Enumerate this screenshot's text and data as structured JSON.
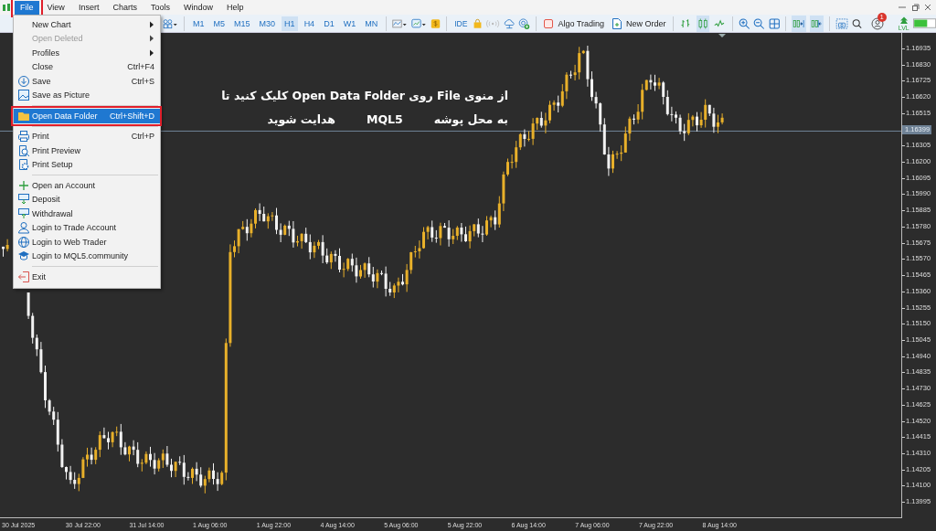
{
  "menubar": {
    "items": [
      {
        "label": "File",
        "selected": true,
        "outlined": true
      },
      {
        "label": "View",
        "selected": false,
        "outlined": false
      },
      {
        "label": "Insert",
        "selected": false,
        "outlined": false
      },
      {
        "label": "Charts",
        "selected": false,
        "outlined": false
      },
      {
        "label": "Tools",
        "selected": false,
        "outlined": false
      },
      {
        "label": "Window",
        "selected": false,
        "outlined": false
      },
      {
        "label": "Help",
        "selected": false,
        "outlined": false
      }
    ]
  },
  "file_menu": {
    "items": [
      {
        "kind": "item",
        "label": "New Chart",
        "submenu": true,
        "disabled": false,
        "selected": false,
        "outlined": false
      },
      {
        "kind": "item",
        "label": "Open Deleted",
        "submenu": true,
        "disabled": true,
        "selected": false,
        "outlined": false
      },
      {
        "kind": "item",
        "label": "Profiles",
        "submenu": true,
        "disabled": false,
        "selected": false,
        "outlined": false
      },
      {
        "kind": "item",
        "label": "Close",
        "shortcut": "Ctrl+F4",
        "submenu": false,
        "disabled": false,
        "selected": false,
        "outlined": false
      },
      {
        "kind": "item",
        "label": "Save",
        "shortcut": "Ctrl+S",
        "submenu": false,
        "disabled": false,
        "selected": false,
        "outlined": false
      },
      {
        "kind": "item",
        "label": "Save as Picture",
        "submenu": false,
        "disabled": false,
        "selected": false,
        "outlined": false
      },
      {
        "kind": "separator"
      },
      {
        "kind": "item",
        "label": "Open Data Folder",
        "shortcut": "Ctrl+Shift+D",
        "submenu": false,
        "disabled": false,
        "selected": true,
        "outlined": true
      },
      {
        "kind": "separator"
      },
      {
        "kind": "item",
        "label": "Print",
        "shortcut": "Ctrl+P",
        "submenu": false,
        "disabled": false,
        "selected": false,
        "outlined": false
      },
      {
        "kind": "item",
        "label": "Print Preview",
        "submenu": false,
        "disabled": false,
        "selected": false,
        "outlined": false
      },
      {
        "kind": "item",
        "label": "Print Setup",
        "submenu": false,
        "disabled": false,
        "selected": false,
        "outlined": false
      },
      {
        "kind": "separator"
      },
      {
        "kind": "item",
        "label": "Open an Account",
        "submenu": false,
        "disabled": false,
        "selected": false,
        "outlined": false
      },
      {
        "kind": "item",
        "label": "Deposit",
        "submenu": false,
        "disabled": false,
        "selected": false,
        "outlined": false
      },
      {
        "kind": "item",
        "label": "Withdrawal",
        "submenu": false,
        "disabled": false,
        "selected": false,
        "outlined": false
      },
      {
        "kind": "item",
        "label": "Login to Trade Account",
        "submenu": false,
        "disabled": false,
        "selected": false,
        "outlined": false
      },
      {
        "kind": "item",
        "label": "Login to Web Trader",
        "submenu": false,
        "disabled": false,
        "selected": false,
        "outlined": false
      },
      {
        "kind": "item",
        "label": "Login to MQL5.community",
        "submenu": false,
        "disabled": false,
        "selected": false,
        "outlined": false
      },
      {
        "kind": "separator"
      },
      {
        "kind": "item",
        "label": "Exit",
        "submenu": false,
        "disabled": false,
        "selected": false,
        "outlined": false
      }
    ]
  },
  "toolbar": {
    "timeframes": [
      {
        "label": "M1",
        "selected": false
      },
      {
        "label": "M5",
        "selected": false
      },
      {
        "label": "M15",
        "selected": false
      },
      {
        "label": "M30",
        "selected": false
      },
      {
        "label": "H1",
        "selected": true
      },
      {
        "label": "H4",
        "selected": false
      },
      {
        "label": "D1",
        "selected": false
      },
      {
        "label": "W1",
        "selected": false
      },
      {
        "label": "MN",
        "selected": false
      }
    ],
    "ide_label": "IDE",
    "algo_trading_label": "Algo Trading",
    "new_order_label": "New Order",
    "chart_modes": [
      {
        "selected": false
      },
      {
        "selected": true
      },
      {
        "selected": false
      }
    ],
    "scroll_toggles": [
      {
        "selected": true
      },
      {
        "selected": true
      }
    ],
    "notification_count": "1",
    "level_label": "LVL"
  },
  "chart": {
    "annotation": {
      "line_1": "از منوی File روی Open Data Folder کلیک کنید تا",
      "line_2": [
        "به محل پوشه",
        "MQL5",
        "هدایت شوید"
      ]
    },
    "price_labels": [
      {
        "label": "1.16935"
      },
      {
        "label": "1.16830"
      },
      {
        "label": "1.16725"
      },
      {
        "label": "1.16620"
      },
      {
        "label": "1.16515"
      },
      {
        "label": "1.16399",
        "current": true
      },
      {
        "label": "1.16305"
      },
      {
        "label": "1.16200"
      },
      {
        "label": "1.16095"
      },
      {
        "label": "1.15990"
      },
      {
        "label": "1.15885"
      },
      {
        "label": "1.15780"
      },
      {
        "label": "1.15675"
      },
      {
        "label": "1.15570"
      },
      {
        "label": "1.15465"
      },
      {
        "label": "1.15360"
      },
      {
        "label": "1.15255"
      },
      {
        "label": "1.15150"
      },
      {
        "label": "1.15045"
      },
      {
        "label": "1.14940"
      },
      {
        "label": "1.14835"
      },
      {
        "label": "1.14730"
      },
      {
        "label": "1.14625"
      },
      {
        "label": "1.14520"
      },
      {
        "label": "1.14415"
      },
      {
        "label": "1.14310"
      },
      {
        "label": "1.14205"
      },
      {
        "label": "1.14100"
      },
      {
        "label": "1.13995"
      }
    ],
    "time_labels": [
      "30 Jul 2025",
      "30 Jul 22:00",
      "31 Jul 14:00",
      "1 Aug 06:00",
      "1 Aug 22:00",
      "4 Aug 14:00",
      "5 Aug 06:00",
      "5 Aug 22:00",
      "6 Aug 14:00",
      "7 Aug 06:00",
      "7 Aug 22:00",
      "8 Aug 14:00"
    ]
  }
}
